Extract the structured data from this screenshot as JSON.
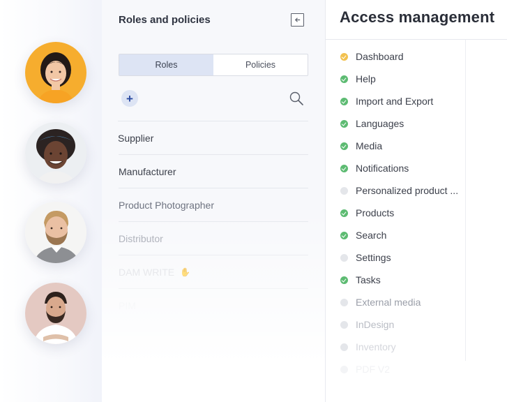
{
  "roles_panel": {
    "title": "Roles and policies",
    "tabs": [
      {
        "label": "Roles",
        "active": true
      },
      {
        "label": "Policies",
        "active": false
      }
    ],
    "add_label": "+",
    "roles": [
      {
        "label": "Supplier"
      },
      {
        "label": "Manufacturer"
      },
      {
        "label": "Product Photographer"
      },
      {
        "label": "Distributor"
      },
      {
        "label": "DAM WRITE"
      },
      {
        "label": "PIM"
      }
    ]
  },
  "access_panel": {
    "title": "Access management",
    "permissions": [
      {
        "label": "Dashboard",
        "status": "partial"
      },
      {
        "label": "Help",
        "status": "granted"
      },
      {
        "label": "Import and Export",
        "status": "granted"
      },
      {
        "label": "Languages",
        "status": "granted"
      },
      {
        "label": "Media",
        "status": "granted"
      },
      {
        "label": "Notifications",
        "status": "granted"
      },
      {
        "label": "Personalized product ...",
        "status": "none"
      },
      {
        "label": "Products",
        "status": "granted"
      },
      {
        "label": "Search",
        "status": "granted"
      },
      {
        "label": "Settings",
        "status": "none"
      },
      {
        "label": "Tasks",
        "status": "granted"
      },
      {
        "label": "External media",
        "status": "none"
      },
      {
        "label": "InDesign",
        "status": "none"
      },
      {
        "label": "Inventory",
        "status": "none"
      },
      {
        "label": "PDF V2",
        "status": "none"
      }
    ]
  },
  "icons": {
    "collapse": "arrow-left-into-box-icon",
    "search": "magnifier-icon",
    "status_granted": "check-circle-icon",
    "status_partial": "check-circle-icon",
    "status_none": "empty-circle-icon",
    "hand": "raised-hand-icon"
  },
  "colors": {
    "granted": "#5dbb72",
    "partial": "#f2c14f",
    "none": "#e4e6ea",
    "active_tab": "#dde4f4",
    "add_button": "#dde4f4"
  }
}
